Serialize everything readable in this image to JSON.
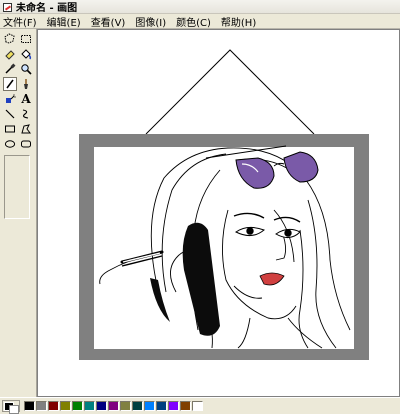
{
  "window": {
    "title": "未命名 - 画图"
  },
  "menu": [
    "文件(F)",
    "编辑(E)",
    "查看(V)",
    "图像(I)",
    "颜色(C)",
    "帮助(H)"
  ],
  "tools": [
    {
      "name": "free-form-select-icon",
      "active": false
    },
    {
      "name": "rect-select-icon",
      "active": false
    },
    {
      "name": "eraser-icon",
      "active": false
    },
    {
      "name": "fill-bucket-icon",
      "active": false
    },
    {
      "name": "eyedropper-icon",
      "active": false
    },
    {
      "name": "magnifier-icon",
      "active": false
    },
    {
      "name": "pencil-icon",
      "active": true
    },
    {
      "name": "brush-icon",
      "active": false
    },
    {
      "name": "airbrush-icon",
      "active": false
    },
    {
      "name": "text-tool-icon",
      "active": false,
      "glyph": "A"
    },
    {
      "name": "line-tool-icon",
      "active": false
    },
    {
      "name": "curve-tool-icon",
      "active": false
    },
    {
      "name": "rectangle-tool-icon",
      "active": false
    },
    {
      "name": "polygon-tool-icon",
      "active": false
    },
    {
      "name": "ellipse-tool-icon",
      "active": false
    },
    {
      "name": "rounded-rect-tool-icon",
      "active": false
    }
  ],
  "colors": {
    "foreground": "#000000",
    "background": "#ffffff",
    "frame": "#808080",
    "glasses": "#7a5aa8",
    "lips": "#d04040"
  },
  "palette": [
    "#000000",
    "#808080",
    "#800000",
    "#808000",
    "#008000",
    "#008080",
    "#000080",
    "#800080",
    "#808040",
    "#004040",
    "#0080ff",
    "#004080",
    "#8000ff",
    "#804000",
    "#ffffff"
  ]
}
